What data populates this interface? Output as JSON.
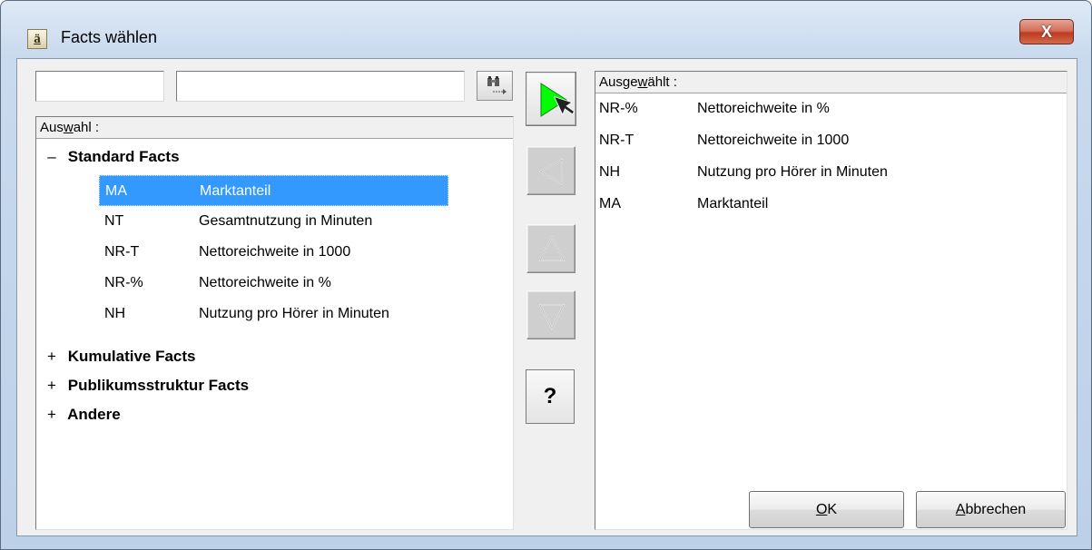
{
  "window": {
    "title": "Facts wählen",
    "icon_glyph": "ä",
    "close_glyph": "X"
  },
  "filter": {
    "code_value": "",
    "text_value": ""
  },
  "left_panel": {
    "header_pre": "Aus",
    "header_mnemonic": "w",
    "header_post": "ahl :",
    "groups": [
      {
        "sign": "–",
        "label": "Standard Facts",
        "items": [
          {
            "code": "MA",
            "desc": "Marktanteil",
            "selected": true
          },
          {
            "code": "NT",
            "desc": "Gesamtnutzung in Minuten"
          },
          {
            "code": "NR-T",
            "desc": "Nettoreichweite in 1000"
          },
          {
            "code": "NR-%",
            "desc": "Nettoreichweite in %"
          },
          {
            "code": "NH",
            "desc": "Nutzung pro Hörer in Minuten"
          }
        ]
      },
      {
        "sign": "+",
        "label": "Kumulative Facts"
      },
      {
        "sign": "+",
        "label": "Publikumsstruktur Facts"
      },
      {
        "sign": "+",
        "label": "Andere"
      }
    ]
  },
  "middle": {
    "help_label": "?"
  },
  "right_panel": {
    "header_pre": "Ausge",
    "header_mnemonic": "w",
    "header_post": "ählt :",
    "items": [
      {
        "code": "NR-%",
        "desc": "Nettoreichweite in %"
      },
      {
        "code": "NR-T",
        "desc": "Nettoreichweite in 1000"
      },
      {
        "code": "NH",
        "desc": "Nutzung pro Hörer in Minuten"
      },
      {
        "code": "MA",
        "desc": "Marktanteil"
      }
    ]
  },
  "buttons": {
    "ok_mnemonic": "O",
    "ok_rest": "K",
    "cancel_mnemonic": "A",
    "cancel_rest": "bbrechen"
  },
  "colors": {
    "selection": "#3399ff",
    "add_arrow": "#00ff00",
    "close_button": "#c8462c"
  }
}
